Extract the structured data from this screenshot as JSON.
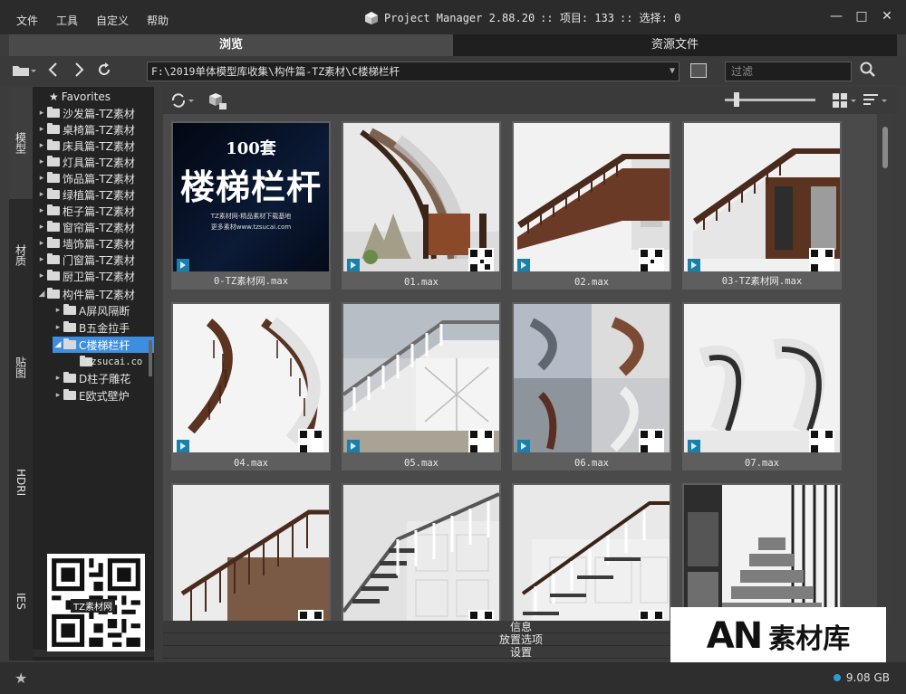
{
  "menu": [
    "文件",
    "工具",
    "自定义",
    "帮助"
  ],
  "app": {
    "title": "Project Manager 2.88.20",
    "items_label": ":: 项目: 133",
    "selection_label": ":: 选择: 0"
  },
  "window_controls": {
    "minimize": "—",
    "maximize": "□",
    "close": "✕"
  },
  "tabs": [
    {
      "label": "浏览",
      "active": true
    },
    {
      "label": "资源文件",
      "active": false
    }
  ],
  "address": {
    "path": "F:\\2019单体模型库收集\\构件篇-TZ素材\\C楼梯栏杆",
    "filter_placeholder": "过滤"
  },
  "side_tabs": [
    "模型",
    "材质",
    "贴图",
    "HDRI",
    "IES"
  ],
  "tree": [
    {
      "label": "Favorites",
      "level": 0,
      "type": "favorites"
    },
    {
      "label": "沙发篇-TZ素材",
      "level": 0,
      "type": "folder",
      "arrow": "▸"
    },
    {
      "label": "桌椅篇-TZ素材",
      "level": 0,
      "type": "folder",
      "arrow": "▸"
    },
    {
      "label": "床具篇-TZ素材",
      "level": 0,
      "type": "folder",
      "arrow": "▸"
    },
    {
      "label": "灯具篇-TZ素材",
      "level": 0,
      "type": "folder",
      "arrow": "▸"
    },
    {
      "label": "饰品篇-TZ素材",
      "level": 0,
      "type": "folder",
      "arrow": "▸"
    },
    {
      "label": "绿植篇-TZ素材",
      "level": 0,
      "type": "folder",
      "arrow": "▸"
    },
    {
      "label": "柜子篇-TZ素材",
      "level": 0,
      "type": "folder",
      "arrow": "▸"
    },
    {
      "label": "窗帘篇-TZ素材",
      "level": 0,
      "type": "folder",
      "arrow": "▸"
    },
    {
      "label": "墙饰篇-TZ素材",
      "level": 0,
      "type": "folder",
      "arrow": "▸"
    },
    {
      "label": "门窗篇-TZ素材",
      "level": 0,
      "type": "folder",
      "arrow": "▸"
    },
    {
      "label": "厨卫篇-TZ素材",
      "level": 0,
      "type": "folder",
      "arrow": "▸"
    },
    {
      "label": "构件篇-TZ素材",
      "level": 0,
      "type": "folder",
      "arrow": "◢"
    },
    {
      "label": "A屏风隔断",
      "level": 1,
      "type": "folder",
      "arrow": "▸"
    },
    {
      "label": "B五金拉手",
      "level": 1,
      "type": "folder",
      "arrow": "▸"
    },
    {
      "label": "C楼梯栏杆",
      "level": 1,
      "type": "folder",
      "arrow": "◢",
      "selected": true
    },
    {
      "label": "tzsucai.co",
      "level": 2,
      "type": "folder",
      "arrow": ""
    },
    {
      "label": "D柱子雕花",
      "level": 1,
      "type": "folder",
      "arrow": "▸"
    },
    {
      "label": "E欧式壁炉",
      "level": 1,
      "type": "folder",
      "arrow": "▸"
    }
  ],
  "qr_label": "TZ素材网",
  "items": [
    {
      "label": "0-TZ素材网.max",
      "style": "poster"
    },
    {
      "label": "01.max",
      "style": "curve-dark"
    },
    {
      "label": "02.max",
      "style": "straight-dark"
    },
    {
      "label": "03-TZ素材网.max",
      "style": "straight-dark2"
    },
    {
      "label": "04.max",
      "style": "spiral-wood"
    },
    {
      "label": "05.max",
      "style": "white-rail"
    },
    {
      "label": "06.max",
      "style": "quad"
    },
    {
      "label": "07.max",
      "style": "white-curve"
    },
    {
      "label": "",
      "style": "wood-rail"
    },
    {
      "label": "",
      "style": "white-post"
    },
    {
      "label": "",
      "style": "white-wall"
    },
    {
      "label": "",
      "style": "cabinet-stair"
    }
  ],
  "poster": {
    "top": "100套",
    "main": "楼梯栏杆",
    "sub1": "TZ素材网-精品素材下载基地",
    "sub2": "更多素材www.tzsucai.com"
  },
  "bottom_panels": [
    "信息",
    "放置选项",
    "设置"
  ],
  "status": {
    "disk": "9.08 GB"
  },
  "watermark": {
    "logo": "AN",
    "text": "素材库"
  }
}
